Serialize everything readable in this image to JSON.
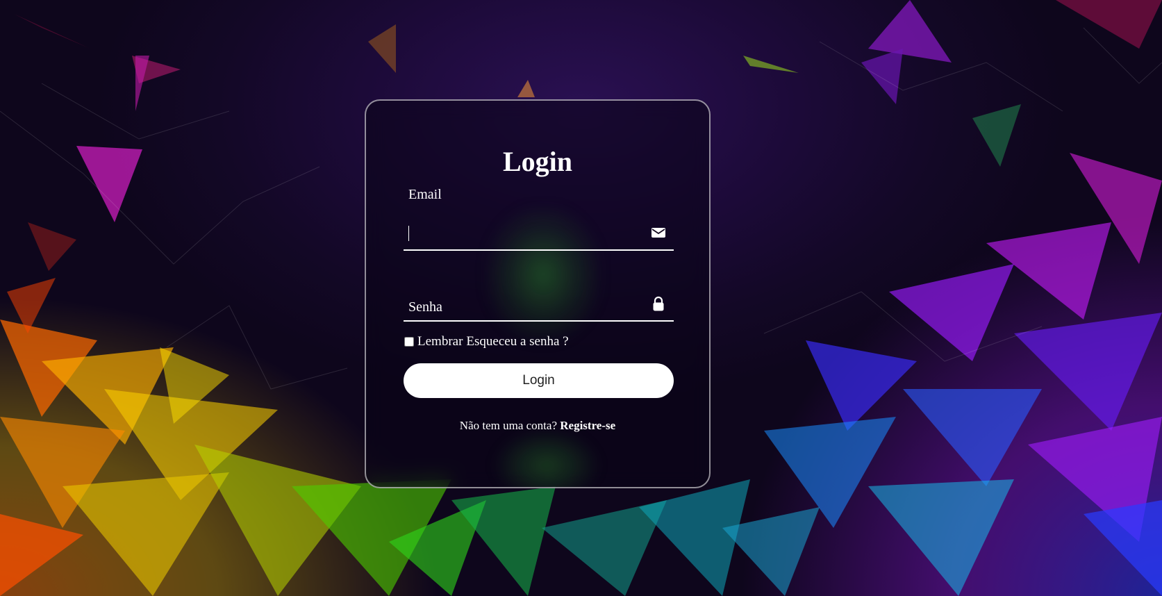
{
  "login_form": {
    "title": "Login",
    "email": {
      "label": "Email",
      "value": "",
      "icon": "envelope-icon"
    },
    "password": {
      "label": "Senha",
      "value": "",
      "icon": "lock-icon"
    },
    "remember_label": "Lembrar",
    "forgot_label": "Esqueceu a senha ?",
    "submit_label": "Login",
    "register_prompt": "Não tem uma conta?",
    "register_link": "Registre-se"
  },
  "colors": {
    "card_border": "#ffffff",
    "button_bg": "#ffffff",
    "text": "#ffffff",
    "background": "#1a0b2e"
  }
}
